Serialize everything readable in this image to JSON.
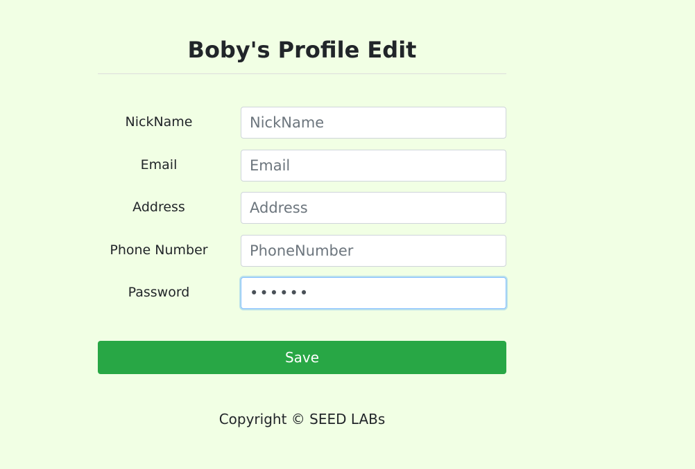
{
  "page": {
    "title": "Boby's Profile Edit"
  },
  "form": {
    "fields": [
      {
        "label": "NickName",
        "placeholder": "NickName",
        "value": ""
      },
      {
        "label": "Email",
        "placeholder": "Email",
        "value": ""
      },
      {
        "label": "Address",
        "placeholder": "Address",
        "value": ""
      },
      {
        "label": "Phone Number",
        "placeholder": "PhoneNumber",
        "value": ""
      },
      {
        "label": "Password",
        "placeholder": "",
        "value": "••••••"
      }
    ],
    "save_label": "Save"
  },
  "footer": {
    "text": "Copyright © SEED LABs"
  },
  "colors": {
    "background": "#f1ffe4",
    "save_button": "#28a745",
    "focus_border": "#80bdff"
  }
}
